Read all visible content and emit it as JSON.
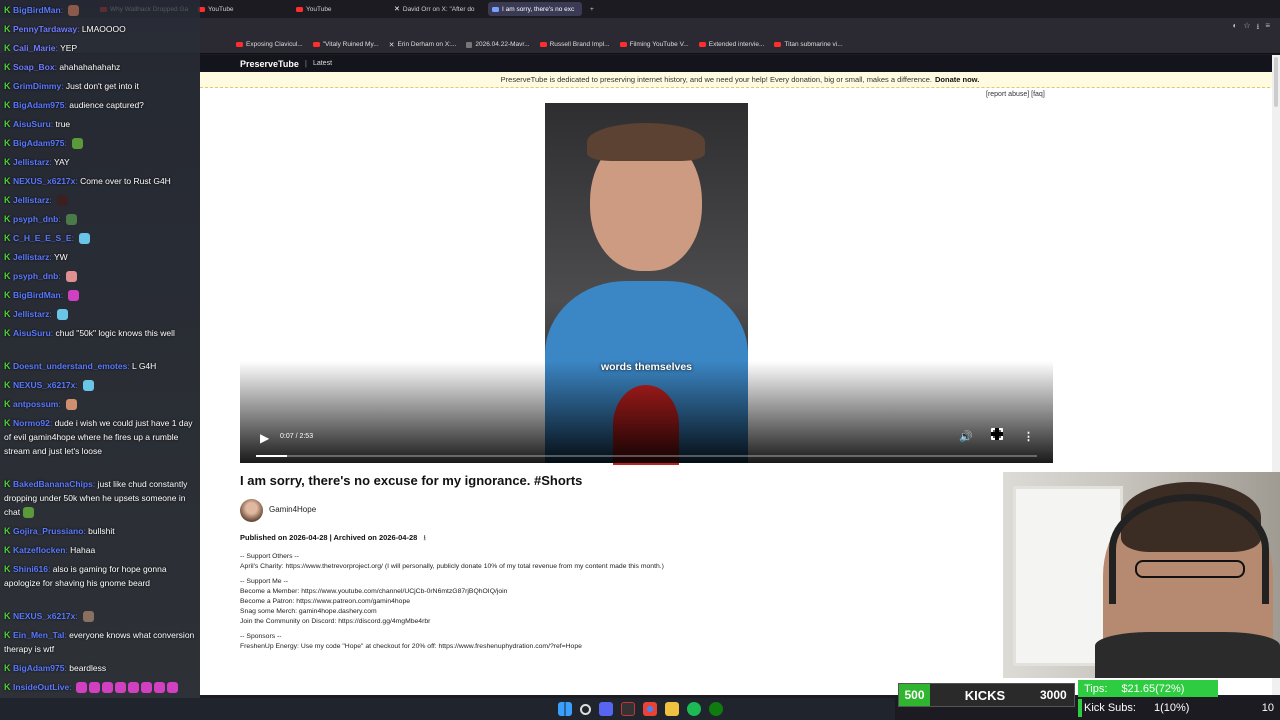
{
  "tabs": [
    {
      "label": "Why Wallhack Dropped Ga",
      "icon": "youtube-icon",
      "active": false
    },
    {
      "label": "YouTube",
      "icon": "youtube-icon",
      "active": false
    },
    {
      "label": "YouTube",
      "icon": "youtube-icon",
      "active": false
    },
    {
      "label": "David Orr on X: \"After do",
      "icon": "x-icon",
      "active": false
    },
    {
      "label": "I am sorry, there's no exc",
      "icon": "preservetube-icon",
      "active": true
    }
  ],
  "bookmarks": [
    {
      "label": "Exposing Clavicul...",
      "icon": "youtube-icon"
    },
    {
      "label": "\"Vitaly Ruined My...",
      "icon": "youtube-icon"
    },
    {
      "label": "Erin Derham on X:...",
      "icon": "x-icon"
    },
    {
      "label": "2026.04.22-Mavr...",
      "icon": "page-icon"
    },
    {
      "label": "Russell Brand Impl...",
      "icon": "youtube-icon"
    },
    {
      "label": "Filming YouTube V...",
      "icon": "youtube-icon"
    },
    {
      "label": "Extended intervie...",
      "icon": "youtube-icon"
    },
    {
      "label": "Titan submarine vi...",
      "icon": "youtube-icon"
    }
  ],
  "site": {
    "logo": "PreserveTube",
    "separator": "|",
    "nav_latest": "Latest",
    "banner_text": "PreserveTube is dedicated to preserving internet history, and we need your help! Every donation, big or small, makes a difference.",
    "banner_link": "Donate now.",
    "report_links": "[report abuse] [faq]"
  },
  "video": {
    "caption": "words themselves",
    "time": "0:07 / 2:53",
    "progress_fraction": 0.04,
    "title": "I am sorry, there's no excuse for my ignorance. #Shorts",
    "channel": "Gamin4Hope",
    "published_label": "Published on 2026-04-28 | Archived on 2026-04-28"
  },
  "description": [
    "-- Support Others --",
    "April's Charity: https://www.thetrevorproject.org/ (I will personally, publicly donate 10% of my total revenue from my content made this month.)",
    "",
    "-- Support Me --",
    "Become a Member: https://www.youtube.com/channel/UCjCb-0rN6mtzG87rjBQhOIQ/join",
    "Become a Patron: https://www.patreon.com/gamin4hope",
    "Snag some Merch: gamin4hope.dashery.com",
    "Join the Community on Discord: https://discord.gg/4mgMbe4rbr",
    "",
    "-- Sponsors --",
    "FreshenUp Energy: Use my code \"Hope\" at checkout for 20% off: https://www.freshenuphydration.com/?ref=Hope"
  ],
  "chat": [
    {
      "user": "BigBirdMan",
      "text": "",
      "color": "#5a78ff",
      "emote": "#8b5a4a"
    },
    {
      "user": "PennyTardaway",
      "text": "LMAOOOO",
      "color": "#6f7bff"
    },
    {
      "user": "Cali_Marie",
      "text": "YEP",
      "color": "#6f7bff"
    },
    {
      "user": "Soap_Box",
      "text": "ahahahahahahz",
      "color": "#6f7bff"
    },
    {
      "user": "GrimDimmy",
      "text": "Just don't get into it",
      "color": "#5a78ff"
    },
    {
      "user": "BigAdam975",
      "text": "audience captured?",
      "color": "#5a78ff"
    },
    {
      "user": "AisuSuru",
      "text": "true",
      "color": "#5a78ff"
    },
    {
      "user": "BigAdam975",
      "text": "",
      "color": "#5a78ff",
      "emote": "#5a9a3a"
    },
    {
      "user": "Jellistarz",
      "text": "YAY",
      "color": "#5a78ff"
    },
    {
      "user": "NEXUS_x6217x",
      "text": "Come over to Rust G4H",
      "color": "#5a78ff"
    },
    {
      "user": "Jellistarz",
      "text": "",
      "color": "#5a78ff",
      "emote": "#3a2020"
    },
    {
      "user": "psyph_dnb",
      "text": "",
      "color": "#5a78ff",
      "emote": "#4a7a4a"
    },
    {
      "user": "C_H_E_E_S_E",
      "text": "",
      "color": "#5a78ff",
      "emote": "#6ac6e8"
    },
    {
      "user": "Jellistarz",
      "text": "YW",
      "color": "#5a78ff"
    },
    {
      "user": "psyph_dnb",
      "text": "",
      "color": "#5a78ff",
      "emote": "#e09090"
    },
    {
      "user": "BigBirdMan",
      "text": "",
      "color": "#5a78ff",
      "emote": "#d040c0"
    },
    {
      "user": "Jellistarz",
      "text": "",
      "color": "#5a78ff",
      "emote": "#6ac6e8"
    },
    {
      "user": "AisuSuru",
      "text": "chud \"50k\" logic knows this well",
      "color": "#5a78ff"
    },
    {
      "user": "Doesnt_understand_emotes",
      "text": "L G4H",
      "color": "#5a78ff"
    },
    {
      "user": "NEXUS_x6217x",
      "text": "",
      "color": "#5a78ff",
      "emote": "#6ac6e8"
    },
    {
      "user": "antpossum",
      "text": "",
      "color": "#5a78ff",
      "emote": "#d09070"
    },
    {
      "user": "Normo92",
      "text": "dude i wish we could just have 1 day of evil gamin4hope where he fires up a rumble stream and just let's loose",
      "color": "#5a78ff"
    },
    {
      "user": "BakedBananaChips",
      "text": "just like chud constantly dropping under 50k when he upsets someone in chat",
      "color": "#5a78ff",
      "emote": "#5a9a3a"
    },
    {
      "user": "Gojira_Prussiano",
      "text": "bullshit",
      "color": "#5a78ff"
    },
    {
      "user": "Katzeflocken",
      "text": "Hahaa",
      "color": "#5a78ff"
    },
    {
      "user": "Shini616",
      "text": "also is gaming for hope gonna apologize for shaving his gnome beard",
      "color": "#5a78ff"
    },
    {
      "user": "NEXUS_x6217x",
      "text": "",
      "color": "#5a78ff",
      "emote": "#8a7060"
    },
    {
      "user": "Ein_Men_Tal",
      "text": "everyone knows what conversion therapy is wtf",
      "color": "#5a78ff"
    },
    {
      "user": "BigAdam975",
      "text": "beardless",
      "color": "#5a78ff"
    },
    {
      "user": "InsideOutLive",
      "text": "",
      "color": "#5a78ff",
      "emote_row": true
    }
  ],
  "overlay": {
    "kicks_current": "500",
    "kicks_label": "KICKS",
    "kicks_goal": "3000",
    "tips_label": "Tips:",
    "tips_value": "$21.65(72%)",
    "tips_goal": "$30",
    "tips_fraction": 0.72,
    "subs_label": "Kick Subs:",
    "subs_value": "1(10%)",
    "subs_goal": "10",
    "subs_fraction": 0.1
  },
  "colors": {
    "tips_green": "#2ecc40",
    "kick_green": "#4cd137",
    "page_bg": "#ffffff"
  }
}
